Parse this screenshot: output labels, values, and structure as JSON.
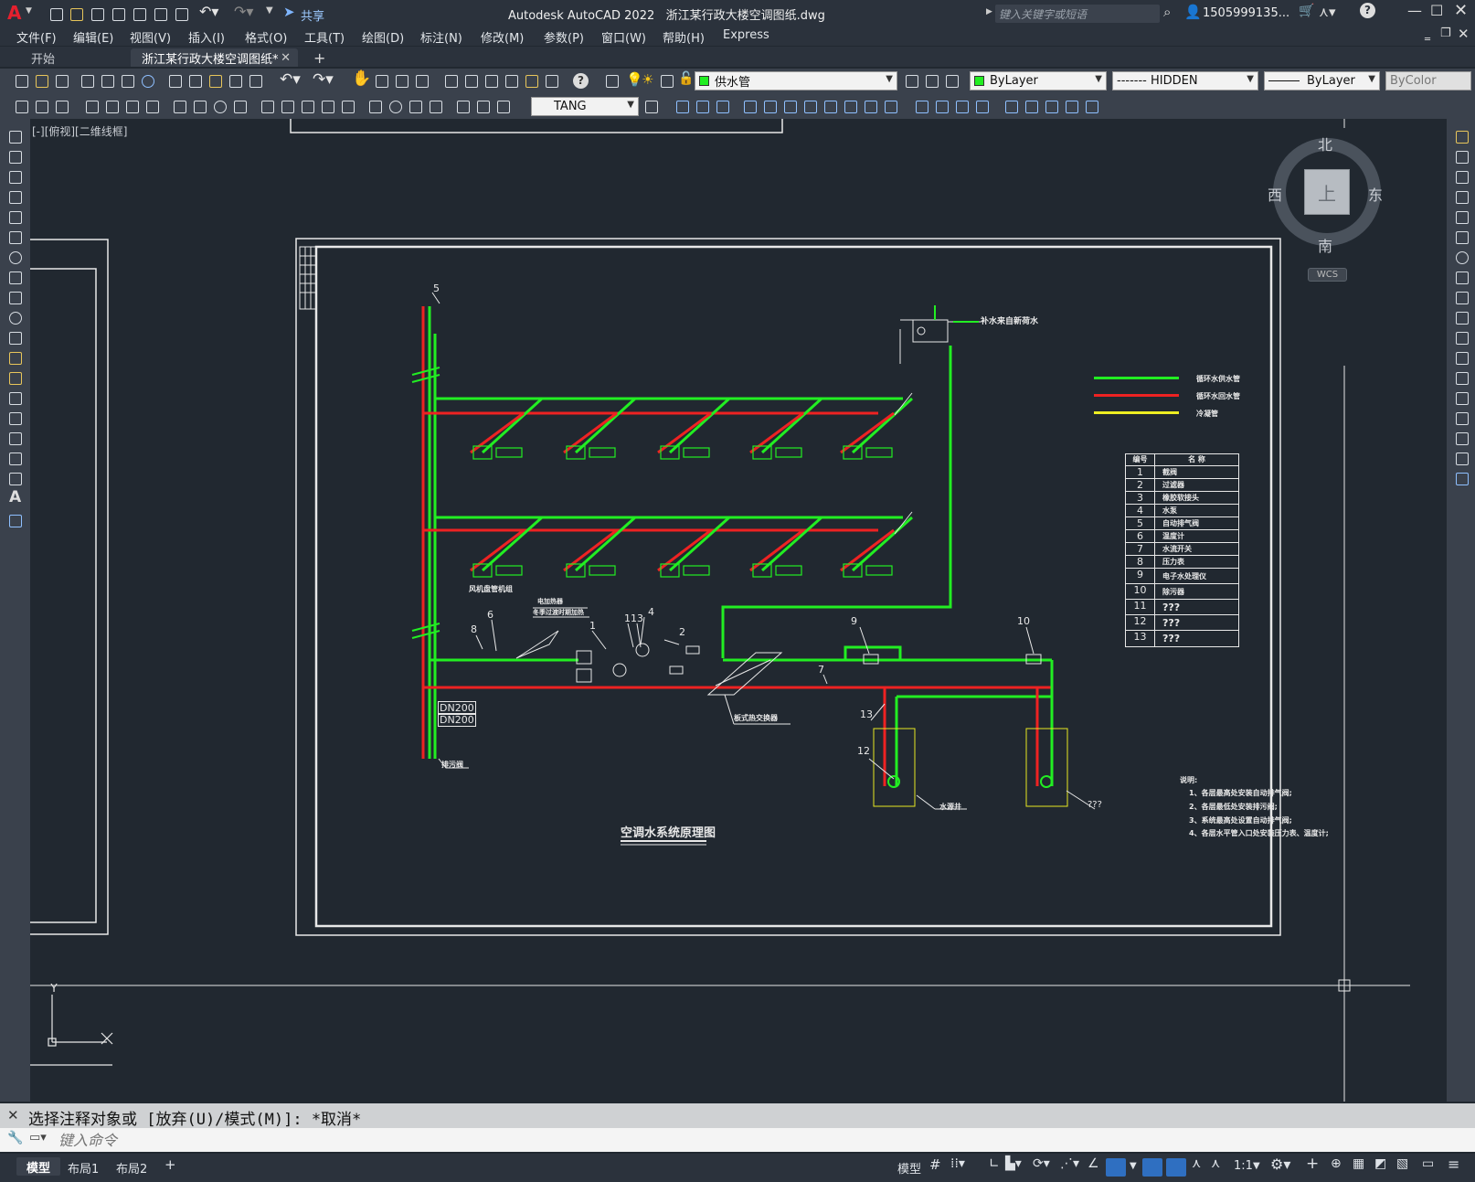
{
  "app": {
    "logo": "A",
    "title": "Autodesk AutoCAD 2022",
    "filename": "浙江某行政大楼空调图纸.dwg",
    "share": "共享",
    "search_placeholder": "键入关键字或短语",
    "user": "1505999135...",
    "help": "?"
  },
  "menu": [
    "文件(F)",
    "编辑(E)",
    "视图(V)",
    "插入(I)",
    "格式(O)",
    "工具(T)",
    "绘图(D)",
    "标注(N)",
    "修改(M)",
    "参数(P)",
    "窗口(W)",
    "帮助(H)",
    "Express"
  ],
  "tabs": {
    "start": "开始",
    "drawing": "浙江某行政大楼空调图纸*",
    "add": "+"
  },
  "toolbar": {
    "layer": "供水管",
    "color": "ByLayer",
    "linetype": "------- HIDDEN",
    "lineweight": "ByLayer",
    "plotstyle": "ByColor",
    "textstyle": "TANG"
  },
  "viewport_label": "[-][俯视][二维线框]",
  "viewcube": {
    "north": "北",
    "south": "南",
    "west": "西",
    "east": "东",
    "top": "上",
    "wcs": "WCS"
  },
  "drawing": {
    "title": "空调水系统原理图",
    "legend": [
      {
        "label": "循环水供水管",
        "color": "#22ee22"
      },
      {
        "label": "循环水回水管",
        "color": "#ee2222"
      },
      {
        "label": "冷凝管",
        "color": "#eeee22"
      }
    ],
    "table_header": [
      "编号",
      "名 称"
    ],
    "table_rows": [
      [
        "1",
        "截阀"
      ],
      [
        "2",
        "过滤器"
      ],
      [
        "3",
        "橡胶软接头"
      ],
      [
        "4",
        "水泵"
      ],
      [
        "5",
        "自动排气阀"
      ],
      [
        "6",
        "温度计"
      ],
      [
        "7",
        "水流开关"
      ],
      [
        "8",
        "压力表"
      ],
      [
        "9",
        "电子水处理仪"
      ],
      [
        "10",
        "除污器"
      ],
      [
        "11",
        "???"
      ],
      [
        "12",
        "???"
      ],
      [
        "13",
        "???"
      ]
    ],
    "labels": {
      "fcu": "风机盘管机组",
      "makeup": "补水来自新荷水",
      "dn1": "DN200",
      "dn2": "DN200",
      "drain": "排污阀",
      "hx": "板式热交换器",
      "well": "水源井",
      "q": "???",
      "elec1": "电加热器",
      "elec2": "冬季过渡时期加热"
    },
    "notes": [
      "说明:",
      "1、各层最高处安装自动排气阀;",
      "2、各层最低处安装排污阀;",
      "3、系统最高处设置自动排气阀;",
      "4、各层水平管入口处安装压力表、温度计;"
    ],
    "numbers": [
      "5",
      "8",
      "6",
      "1",
      "11",
      "3",
      "4",
      "2",
      "9",
      "10",
      "7",
      "13",
      "12"
    ]
  },
  "command": {
    "history": "选择注释对象或 [放弃(U)/模式(M)]: *取消*",
    "placeholder": "键入命令"
  },
  "layout_tabs": [
    "模型",
    "布局1",
    "布局2",
    "+"
  ],
  "status": {
    "model": "模型",
    "scale": "1:1"
  }
}
